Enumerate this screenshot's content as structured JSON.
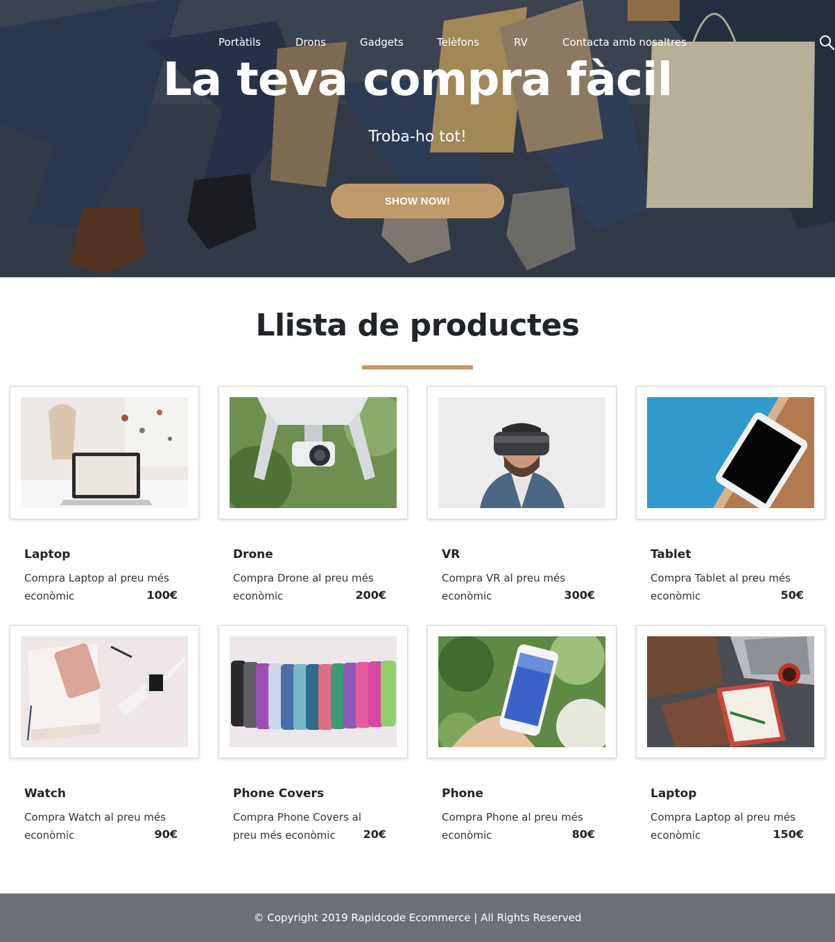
{
  "colors": {
    "accent": "#c19a6b",
    "footer_bg": "#6c7079",
    "text_dark": "#212529"
  },
  "nav": {
    "items": [
      {
        "label": "Portàtils"
      },
      {
        "label": "Drons"
      },
      {
        "label": "Gadgets"
      },
      {
        "label": "Telèfons"
      },
      {
        "label": "RV"
      },
      {
        "label": "Contacta amb nosaltres"
      }
    ],
    "search_icon": "search-icon"
  },
  "hero": {
    "title": "La teva compra fàcil",
    "subtitle": "Troba-ho tot!",
    "button_label": "SHOW NOW!"
  },
  "products_section": {
    "title": "Llista de productes",
    "items": [
      {
        "name": "Laptop",
        "description": "Compra Laptop al preu més econòmic",
        "price": "100€",
        "image": "laptop-photo"
      },
      {
        "name": "Drone",
        "description": "Compra Drone al preu més econòmic",
        "price": "200€",
        "image": "drone-photo"
      },
      {
        "name": "VR",
        "description": "Compra VR al preu més econòmic",
        "price": "300€",
        "image": "vr-headset-photo"
      },
      {
        "name": "Tablet",
        "description": "Compra Tablet al preu més econòmic",
        "price": "50€",
        "image": "tablet-photo"
      },
      {
        "name": "Watch",
        "description": "Compra Watch al preu més econòmic",
        "price": "90€",
        "image": "watch-photo"
      },
      {
        "name": "Phone Covers",
        "description": "Compra Phone Covers al preu més econòmic",
        "price": "20€",
        "image": "phone-covers-photo"
      },
      {
        "name": "Phone",
        "description": "Compra Phone al preu més econòmic",
        "price": "80€",
        "image": "phone-photo"
      },
      {
        "name": "Laptop",
        "description": "Compra Laptop al preu més econòmic",
        "price": "150€",
        "image": "laptop-desk-photo"
      }
    ]
  },
  "footer": {
    "copyright": "© Copyright 2019 Rapidcode Ecommerce | All Rights Reserved"
  }
}
